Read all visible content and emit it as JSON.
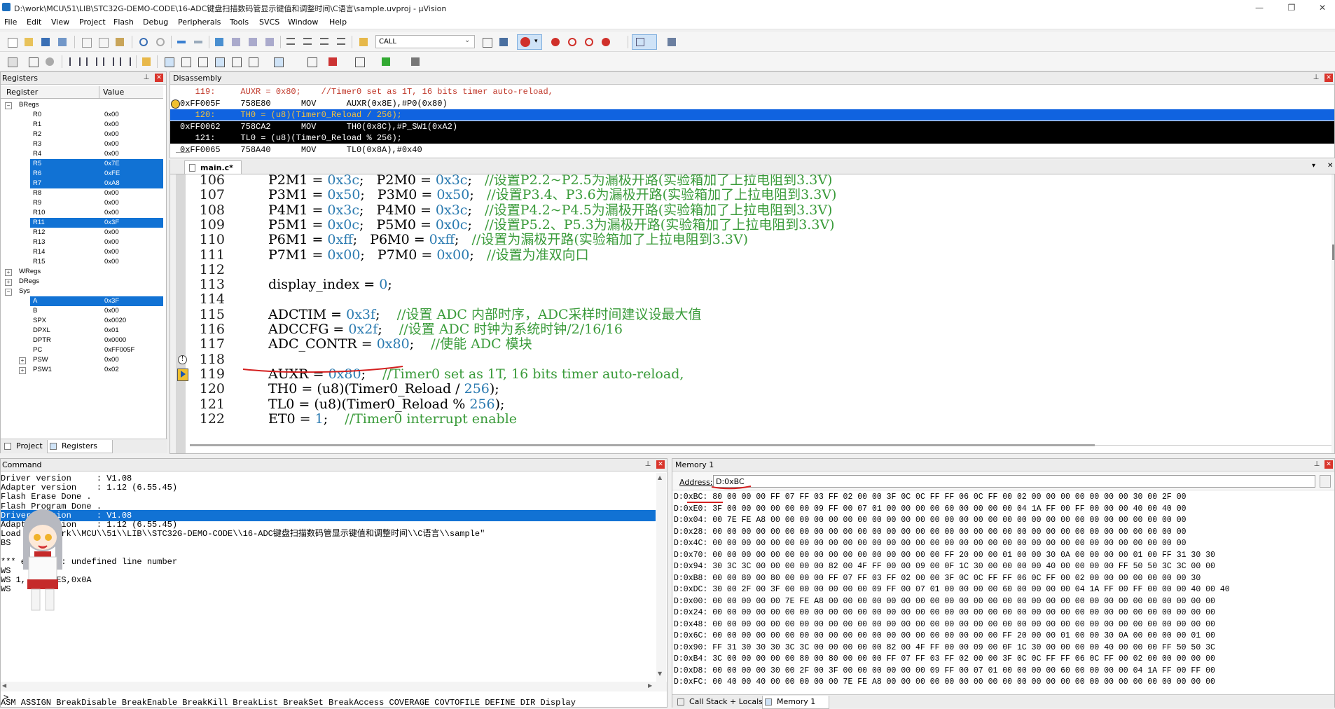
{
  "window": {
    "title": "D:\\work\\MCU\\51\\LIB\\STC32G-DEMO-CODE\\16-ADC键盘扫描数码管显示键值和调整时间\\C语言\\sample.uvproj - µVision"
  },
  "menu": [
    "File",
    "Edit",
    "View",
    "Project",
    "Flash",
    "Debug",
    "Peripherals",
    "Tools",
    "SVCS",
    "Window",
    "Help"
  ],
  "toolbar": {
    "find_combo": "CALL"
  },
  "registers": {
    "title": "Registers",
    "col_register": "Register",
    "col_value": "Value",
    "rows": [
      {
        "kind": "group",
        "name": "BRegs",
        "exp": "−"
      },
      {
        "name": "R0",
        "value": "0x00"
      },
      {
        "name": "R1",
        "value": "0x00"
      },
      {
        "name": "R2",
        "value": "0x00"
      },
      {
        "name": "R3",
        "value": "0x00"
      },
      {
        "name": "R4",
        "value": "0x00"
      },
      {
        "name": "R5",
        "value": "0x7E",
        "sel": true
      },
      {
        "name": "R6",
        "value": "0xFE",
        "sel": true
      },
      {
        "name": "R7",
        "value": "0xA8",
        "sel": true
      },
      {
        "name": "R8",
        "value": "0x00"
      },
      {
        "name": "R9",
        "value": "0x00"
      },
      {
        "name": "R10",
        "value": "0x00"
      },
      {
        "name": "R11",
        "value": "0x3F",
        "sel": true
      },
      {
        "name": "R12",
        "value": "0x00"
      },
      {
        "name": "R13",
        "value": "0x00"
      },
      {
        "name": "R14",
        "value": "0x00"
      },
      {
        "name": "R15",
        "value": "0x00"
      },
      {
        "kind": "group",
        "name": "WRegs",
        "exp": "+"
      },
      {
        "kind": "group",
        "name": "DRegs",
        "exp": "+"
      },
      {
        "kind": "group",
        "name": "Sys",
        "exp": "−"
      },
      {
        "name": "A",
        "value": "0x3F",
        "sel": true
      },
      {
        "name": "B",
        "value": "0x00"
      },
      {
        "name": "SPX",
        "value": "0x0020"
      },
      {
        "name": "DPXL",
        "value": "0x01"
      },
      {
        "name": "DPTR",
        "value": "0x0000"
      },
      {
        "name": "PC",
        "value": "0xFF005F"
      },
      {
        "name": "PSW",
        "value": "0x00",
        "exp": "+"
      },
      {
        "name": "PSW1",
        "value": "0x02",
        "exp": "+"
      }
    ],
    "tabs": [
      "Project",
      "Registers"
    ]
  },
  "disassembly": {
    "title": "Disassembly",
    "lines": [
      {
        "t": "src",
        "text": "   119:     AUXR = 0x80;    //Timer0 set as 1T, 16 bits timer auto-reload,"
      },
      {
        "t": "asm",
        "text": "0xFF005F    758E80      MOV      AUXR(0x8E),#P0(0x80)",
        "arrow": true
      },
      {
        "t": "blue",
        "text": "   120:     TH0 = (u8)(Timer0_Reload / 256);"
      },
      {
        "t": "black",
        "text": "0xFF0062    758CA2      MOV      TH0(0x8C),#P_SW1(0xA2)"
      },
      {
        "t": "black",
        "text": "   121:     TL0 = (u8)(Timer0_Reload % 256);"
      },
      {
        "t": "asm",
        "text": "0xFF0065    758A40      MOV      TL0(0x8A),#0x40"
      }
    ]
  },
  "editor": {
    "tab": "main.c*",
    "lines": [
      {
        "n": "106",
        "segs": [
          [
            "P2M1 = ",
            ""
          ],
          [
            "0x3c",
            "num"
          ],
          [
            ";   P2M0 = ",
            ""
          ],
          [
            "0x3c",
            "num"
          ],
          [
            ";   ",
            ""
          ],
          [
            "//设置P2.2~P2.5为漏极开路(实验箱加了上拉电阻到3.3V)",
            "cmt"
          ]
        ]
      },
      {
        "n": "107",
        "segs": [
          [
            "P3M1 = ",
            ""
          ],
          [
            "0x50",
            "num"
          ],
          [
            ";   P3M0 = ",
            ""
          ],
          [
            "0x50",
            "num"
          ],
          [
            ";   ",
            ""
          ],
          [
            "//设置P3.4、P3.6为漏极开路(实验箱加了上拉电阻到3.3V)",
            "cmt"
          ]
        ]
      },
      {
        "n": "108",
        "segs": [
          [
            "P4M1 = ",
            ""
          ],
          [
            "0x3c",
            "num"
          ],
          [
            ";   P4M0 = ",
            ""
          ],
          [
            "0x3c",
            "num"
          ],
          [
            ";   ",
            ""
          ],
          [
            "//设置P4.2~P4.5为漏极开路(实验箱加了上拉电阻到3.3V)",
            "cmt"
          ]
        ]
      },
      {
        "n": "109",
        "segs": [
          [
            "P5M1 = ",
            ""
          ],
          [
            "0x0c",
            "num"
          ],
          [
            ";   P5M0 = ",
            ""
          ],
          [
            "0x0c",
            "num"
          ],
          [
            ";   ",
            ""
          ],
          [
            "//设置P5.2、P5.3为漏极开路(实验箱加了上拉电阻到3.3V)",
            "cmt"
          ]
        ]
      },
      {
        "n": "110",
        "segs": [
          [
            "P6M1 = ",
            ""
          ],
          [
            "0xff",
            "num"
          ],
          [
            ";   P6M0 = ",
            ""
          ],
          [
            "0xff",
            "num"
          ],
          [
            ";   ",
            ""
          ],
          [
            "//设置为漏极开路(实验箱加了上拉电阻到3.3V)",
            "cmt"
          ]
        ]
      },
      {
        "n": "111",
        "segs": [
          [
            "P7M1 = ",
            ""
          ],
          [
            "0x00",
            "num"
          ],
          [
            ";   P7M0 = ",
            ""
          ],
          [
            "0x00",
            "num"
          ],
          [
            ";   ",
            ""
          ],
          [
            "//设置为准双向口",
            "cmt"
          ]
        ]
      },
      {
        "n": "112",
        "segs": []
      },
      {
        "n": "113",
        "segs": [
          [
            "display_index = ",
            ""
          ],
          [
            "0",
            "num"
          ],
          [
            ";",
            ""
          ]
        ]
      },
      {
        "n": "114",
        "segs": []
      },
      {
        "n": "115",
        "segs": [
          [
            "ADCTIM = ",
            ""
          ],
          [
            "0x3f",
            "num"
          ],
          [
            ";    ",
            ""
          ],
          [
            "//设置 ADC 内部时序，ADC采样时间建议设最大值",
            "cmt"
          ]
        ]
      },
      {
        "n": "116",
        "segs": [
          [
            "ADCCFG = ",
            ""
          ],
          [
            "0x2f",
            "num"
          ],
          [
            ";    ",
            ""
          ],
          [
            "//设置 ADC 时钟为系统时钟/2/16/16",
            "cmt"
          ]
        ]
      },
      {
        "n": "117",
        "segs": [
          [
            "ADC_CONTR = ",
            ""
          ],
          [
            "0x80",
            "num"
          ],
          [
            ";    ",
            ""
          ],
          [
            "//使能 ADC 模块",
            "cmt"
          ]
        ]
      },
      {
        "n": "118",
        "segs": [],
        "mark": "warn"
      },
      {
        "n": "119",
        "segs": [
          [
            "AUXR = ",
            ""
          ],
          [
            "0x80",
            "num"
          ],
          [
            ";    ",
            ""
          ],
          [
            "//Timer0 set as 1T, 16 bits timer auto-reload,",
            "cmt"
          ]
        ],
        "mark": "arrow"
      },
      {
        "n": "120",
        "segs": [
          [
            "TH0 = (u8)(Timer0_Reload / ",
            ""
          ],
          [
            "256",
            "num"
          ],
          [
            ");",
            ""
          ]
        ]
      },
      {
        "n": "121",
        "segs": [
          [
            "TL0 = (u8)(Timer0_Reload % ",
            ""
          ],
          [
            "256",
            "num"
          ],
          [
            ");",
            ""
          ]
        ]
      },
      {
        "n": "122",
        "segs": [
          [
            "ET0 = ",
            ""
          ],
          [
            "1",
            "num"
          ],
          [
            ";    ",
            ""
          ],
          [
            "//Timer0 interrupt enable",
            "cmt"
          ]
        ]
      }
    ]
  },
  "command": {
    "title": "Command",
    "lines": [
      {
        "text": "Driver version     : V1.08"
      },
      {
        "text": "Adapter version    : 1.12 (6.55.45)"
      },
      {
        "text": "Flash Erase Done ."
      },
      {
        "text": "Flash Program Done ."
      },
      {
        "text": "Driver version     : V1.08",
        "sel": true
      },
      {
        "text": "Adapter version    : 1.12 (6.55.45)"
      },
      {
        "text": "Load \"D:\\\\work\\\\MCU\\\\51\\\\LIB\\\\STC32G-DEMO-CODE\\\\16-ADC键盘扫描数码管显示键值和调整时间\\\\C语言\\\\sample\""
      },
      {
        "text": "BS"
      },
      {
        "text": ""
      },
      {
        "text": "*** error 65: undefined line number"
      },
      {
        "text": "WS"
      },
      {
        "text": "WS 1, ADC_RES,0x0A"
      },
      {
        "text": "WS"
      }
    ],
    "prompt": ">",
    "autocomplete": "ASM ASSIGN BreakDisable BreakEnable BreakKill BreakList BreakSet BreakAccess COVERAGE COVTOFILE DEFINE DIR Display"
  },
  "memory": {
    "title": "Memory 1",
    "address_label": "Address:",
    "address_value": "D:0xBC",
    "lines": [
      "D:0xBC: 80 00 00 00 FF 07 FF 03 FF 02 00 00 3F 0C 0C FF FF 06 0C FF 00 02 00 00 00 00 00 00 00 30 00 2F 00",
      "D:0xE0: 3F 00 00 00 00 00 00 09 FF 00 07 01 00 00 00 00 60 00 00 00 00 04 1A FF 00 FF 00 00 00 40 00 40 00",
      "D:0x04: 00 7E FE A8 00 00 00 00 00 00 00 00 00 00 00 00 00 00 00 00 00 00 00 00 00 00 00 00 00 00 00 00 00",
      "D:0x28: 00 00 00 00 00 00 00 00 00 00 00 00 00 00 00 00 00 00 00 00 00 00 00 00 00 00 00 00 00 00 00 00 00",
      "D:0x4C: 00 00 00 00 00 00 00 00 00 00 00 00 00 00 00 00 00 00 00 00 00 00 00 00 00 00 00 00 00 00 00 00 00",
      "D:0x70: 00 00 00 00 00 00 00 00 00 00 00 00 00 00 00 00 FF 20 00 00 01 00 00 30 0A 00 00 00 00 01 00 FF 31 30 30",
      "D:0x94: 30 3C 3C 00 00 00 00 00 82 00 4F FF 00 00 09 00 0F 1C 30 00 00 00 00 40 00 00 00 00 FF 50 50 3C 3C 00 00",
      "D:0xB8: 00 00 80 00 80 00 00 00 FF 07 FF 03 FF 02 00 00 3F 0C 0C FF FF 06 0C FF 00 02 00 00 00 00 00 00 00 30",
      "D:0xDC: 30 00 2F 00 3F 00 00 00 00 00 00 09 FF 00 07 01 00 00 00 00 60 00 00 00 00 04 1A FF 00 FF 00 00 00 40 00 40",
      "D:0x00: 00 00 00 00 00 7E FE A8 00 00 00 00 00 00 00 00 00 00 00 00 00 00 00 00 00 00 00 00 00 00 00 00 00 00 00",
      "D:0x24: 00 00 00 00 00 00 00 00 00 00 00 00 00 00 00 00 00 00 00 00 00 00 00 00 00 00 00 00 00 00 00 00 00 00 00",
      "D:0x48: 00 00 00 00 00 00 00 00 00 00 00 00 00 00 00 00 00 00 00 00 00 00 00 00 00 00 00 00 00 00 00 00 00 00 00",
      "D:0x6C: 00 00 00 00 00 00 00 00 00 00 00 00 00 00 00 00 00 00 00 00 FF 20 00 00 01 00 00 30 0A 00 00 00 00 01 00",
      "D:0x90: FF 31 30 30 30 3C 3C 00 00 00 00 00 82 00 4F FF 00 00 09 00 0F 1C 30 00 00 00 00 40 00 00 00 FF 50 50 3C",
      "D:0xB4: 3C 00 00 00 00 00 80 00 80 00 00 00 FF 07 FF 03 FF 02 00 00 3F 0C 0C FF FF 06 0C FF 00 02 00 00 00 00 00",
      "D:0xD8: 00 00 00 00 30 00 2F 00 3F 00 00 00 00 00 00 09 FF 00 07 01 00 00 00 00 60 00 00 00 00 04 1A FF 00 FF 00",
      "D:0xFC: 00 40 00 40 00 00 00 00 00 7E FE A8 00 00 00 00 00 00 00 00 00 00 00 00 00 00 00 00 00 00 00 00 00 00 00"
    ],
    "tabs": [
      "Call Stack + Locals",
      "Memory 1"
    ]
  },
  "colors": {
    "selection": "#1172d4",
    "number": "#2a7ab0",
    "comment": "#3a9b3a",
    "annotation": "#d42020"
  }
}
